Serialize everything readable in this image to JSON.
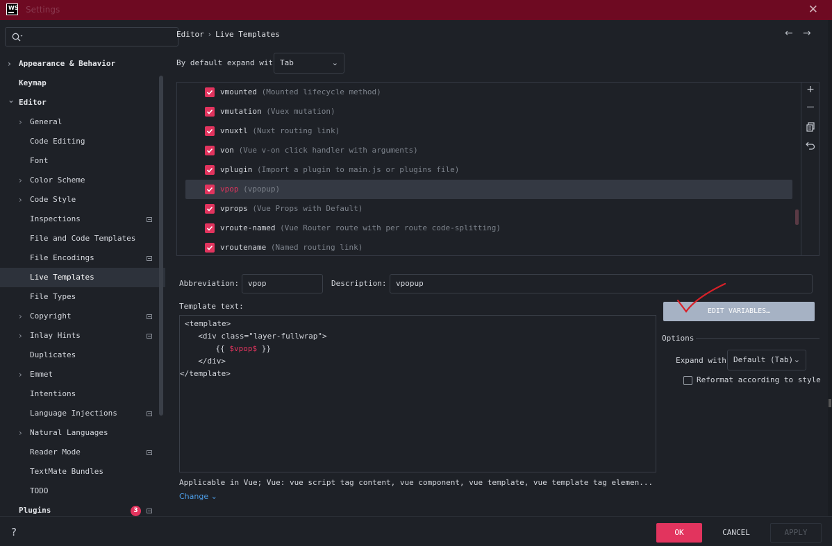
{
  "window": {
    "title": "Settings",
    "logo_text": "WS"
  },
  "search": {
    "placeholder": ""
  },
  "sidebar": {
    "items": [
      {
        "label": "Appearance & Behavior",
        "level": 0,
        "chevron": "right",
        "bold": true
      },
      {
        "label": "Keymap",
        "level": 0,
        "bold": true
      },
      {
        "label": "Editor",
        "level": 0,
        "chevron": "down",
        "bold": true
      },
      {
        "label": "General",
        "level": 1,
        "chevron": "right"
      },
      {
        "label": "Code Editing",
        "level": 1
      },
      {
        "label": "Font",
        "level": 1
      },
      {
        "label": "Color Scheme",
        "level": 1,
        "chevron": "right"
      },
      {
        "label": "Code Style",
        "level": 1,
        "chevron": "right"
      },
      {
        "label": "Inspections",
        "level": 1,
        "settings_icon": true
      },
      {
        "label": "File and Code Templates",
        "level": 1
      },
      {
        "label": "File Encodings",
        "level": 1,
        "settings_icon": true
      },
      {
        "label": "Live Templates",
        "level": 1,
        "selected": true
      },
      {
        "label": "File Types",
        "level": 1
      },
      {
        "label": "Copyright",
        "level": 1,
        "chevron": "right",
        "settings_icon": true
      },
      {
        "label": "Inlay Hints",
        "level": 1,
        "chevron": "right",
        "settings_icon": true
      },
      {
        "label": "Duplicates",
        "level": 1
      },
      {
        "label": "Emmet",
        "level": 1,
        "chevron": "right"
      },
      {
        "label": "Intentions",
        "level": 1
      },
      {
        "label": "Language Injections",
        "level": 1,
        "settings_icon": true
      },
      {
        "label": "Natural Languages",
        "level": 1,
        "chevron": "right"
      },
      {
        "label": "Reader Mode",
        "level": 1,
        "settings_icon": true
      },
      {
        "label": "TextMate Bundles",
        "level": 1
      },
      {
        "label": "TODO",
        "level": 1
      },
      {
        "label": "Plugins",
        "level": 0,
        "bold": true,
        "badge": "3",
        "settings_icon": true
      }
    ]
  },
  "breadcrumb": {
    "parent": "Editor",
    "separator": "›",
    "current": "Live Templates"
  },
  "expand_default": {
    "label": "By default expand with",
    "value": "Tab"
  },
  "templates": [
    {
      "abbr": "vmounted",
      "desc": "(Mounted lifecycle method)",
      "checked": true
    },
    {
      "abbr": "vmutation",
      "desc": "(Vuex mutation)",
      "checked": true
    },
    {
      "abbr": "vnuxtl",
      "desc": "(Nuxt routing link)",
      "checked": true
    },
    {
      "abbr": "von",
      "desc": "(Vue v-on click handler with arguments)",
      "checked": true
    },
    {
      "abbr": "vplugin",
      "desc": "(Import a plugin to main.js or plugins file)",
      "checked": true
    },
    {
      "abbr": "vpop",
      "desc": "(vpopup)",
      "checked": true,
      "selected": true
    },
    {
      "abbr": "vprops",
      "desc": "(Vue Props with Default)",
      "checked": true
    },
    {
      "abbr": "vroute-named",
      "desc": "(Vue Router route with per route code-splitting)",
      "checked": true
    },
    {
      "abbr": "vroutename",
      "desc": "(Named routing link)",
      "checked": true
    }
  ],
  "toolbar": {
    "add": "+",
    "remove": "—"
  },
  "details": {
    "abbreviation_label": "Abbreviation:",
    "abbreviation_value": "vpop",
    "description_label": "Description:",
    "description_value": "vpopup",
    "template_text_label": "Template text:",
    "code_lines": [
      {
        "pre": "<template>",
        "var": "",
        "post": ""
      },
      {
        "pre": "  <div class=\"layer-fullwrap\">",
        "var": "",
        "post": ""
      },
      {
        "pre": "    {{ ",
        "var": "$vpop$",
        "post": " }}"
      },
      {
        "pre": "  </div>",
        "var": "",
        "post": ""
      },
      {
        "pre": "</template>",
        "var": "",
        "post": ""
      }
    ],
    "applicable_text": "Applicable in Vue; Vue: vue script tag content, vue component, vue template, vue template tag elemen...",
    "change_link": "Change",
    "edit_variables": "EDIT VARIABLES…",
    "options_label": "Options",
    "expand_with_label": "Expand with",
    "expand_with_value": "Default (Tab)",
    "reformat_label": "Reformat according to style",
    "reformat_checked": false
  },
  "footer": {
    "help": "?",
    "ok": "OK",
    "cancel": "CANCEL",
    "apply": "APPLY"
  },
  "colors": {
    "accent": "#e2345e",
    "title_bar": "#6e0a22",
    "background": "#1e2127",
    "link": "#4d9ee8"
  }
}
